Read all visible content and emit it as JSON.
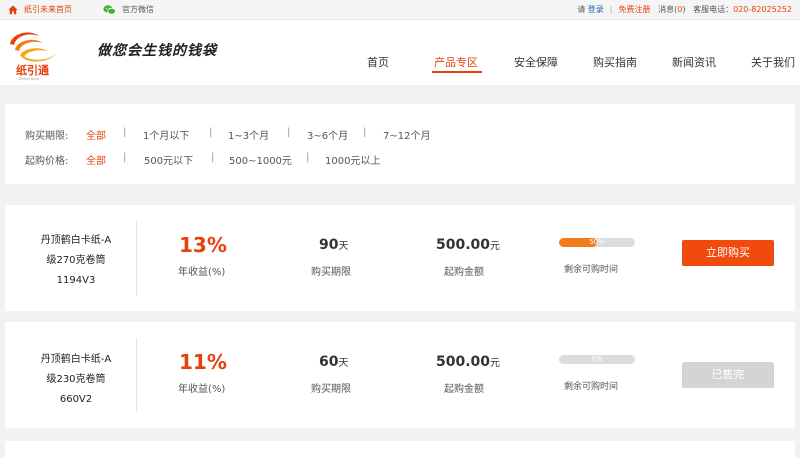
{
  "topbar": {
    "home_label": "纸引未来首页",
    "wechat_label": "官方微信",
    "please": "请",
    "login": "登录",
    "separator": "|",
    "register": "免费注册",
    "messages_label": "消息(",
    "messages_count": "0",
    "messages_close": ")",
    "hotline_label": "客服电话：",
    "hotline": "020-82025252"
  },
  "logo": {
    "text": "纸引通",
    "small": "Zhiyin tong"
  },
  "slogan": "做您会生钱的钱袋",
  "nav": {
    "items": [
      {
        "label": "首页"
      },
      {
        "label": "产品专区"
      },
      {
        "label": "安全保障"
      },
      {
        "label": "购买指南"
      },
      {
        "label": "新闻资讯"
      },
      {
        "label": "关于我们"
      }
    ],
    "active": "产品专区"
  },
  "filters": {
    "period": {
      "label": "购买期限:",
      "options": [
        "全部",
        "1个月以下",
        "1~3个月",
        "3~6个月",
        "7~12个月"
      ],
      "active": "全部"
    },
    "price": {
      "label": "起购价格:",
      "options": [
        "全部",
        "500元以下",
        "500~1000元",
        "1000元以上"
      ],
      "active": "全部"
    },
    "divider": "|"
  },
  "products": [
    {
      "name_lines": [
        "丹顶鹤白卡纸-A",
        "级270克卷筒",
        "1194V3"
      ],
      "rate": "13%",
      "rate_label": "年收益(%)",
      "term_value": "90",
      "term_unit": "天",
      "term_label": "购买期限",
      "amount_value": "500.00",
      "amount_unit": "元",
      "amount_label": "起购金额",
      "progress_percent": 50,
      "progress_text": "50%",
      "progress_label": "剩余可购时间",
      "button_label": "立即购买",
      "button_state": "available"
    },
    {
      "name_lines": [
        "丹顶鹤白卡纸-A",
        "级230克卷筒",
        "660V2"
      ],
      "rate": "11%",
      "rate_label": "年收益(%)",
      "term_value": "60",
      "term_unit": "天",
      "term_label": "购买期限",
      "amount_value": "500.00",
      "amount_unit": "元",
      "amount_label": "起购金额",
      "progress_percent": 0,
      "progress_text": "0%",
      "progress_label": "剩余可购时间",
      "button_label": "已售完",
      "button_state": "sold-out"
    }
  ],
  "colors": {
    "accent": "#e8400c",
    "buy_button": "#f04a0c",
    "sold_button": "#d4d4d4",
    "progress_fill": "#f47b1a",
    "link_blue": "#1a62b8"
  }
}
